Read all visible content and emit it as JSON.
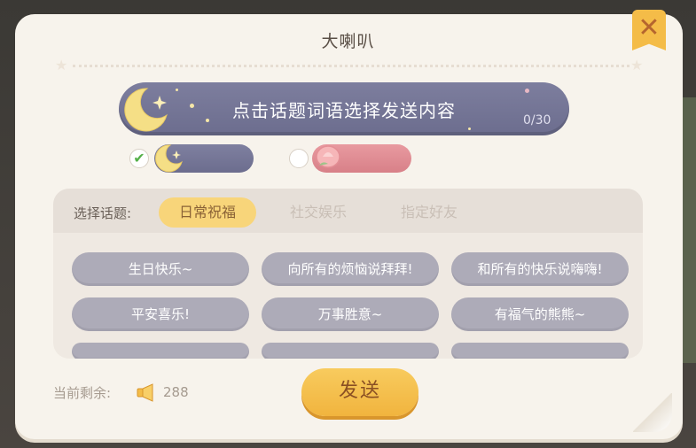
{
  "dialog": {
    "title": "大喇叭",
    "close_icon": "close-icon"
  },
  "message_input": {
    "placeholder": "点击话题词语选择发送内容",
    "counter": "0/30"
  },
  "styles": [
    {
      "name": "moon",
      "selected": true,
      "icon": "moon-star-icon"
    },
    {
      "name": "flower",
      "selected": false,
      "icon": "peach-flower-icon"
    }
  ],
  "topics": {
    "label": "选择话题:",
    "tabs": [
      "日常祝福",
      "社交娱乐",
      "指定好友"
    ],
    "active_tab": 0,
    "phrases": [
      "生日快乐~",
      "向所有的烦恼说拜拜!",
      "和所有的快乐说嗨嗨!",
      "平安喜乐!",
      "万事胜意~",
      "有福气的熊熊~"
    ]
  },
  "balance": {
    "label": "当前剩余:",
    "icon": "horn-icon",
    "value": "288"
  },
  "send_button": {
    "label": "发送"
  },
  "colors": {
    "accent": "#f4bc48",
    "chip": "#adabb8",
    "input_bar": "#7d7e9e",
    "flower": "#e89aa0"
  }
}
